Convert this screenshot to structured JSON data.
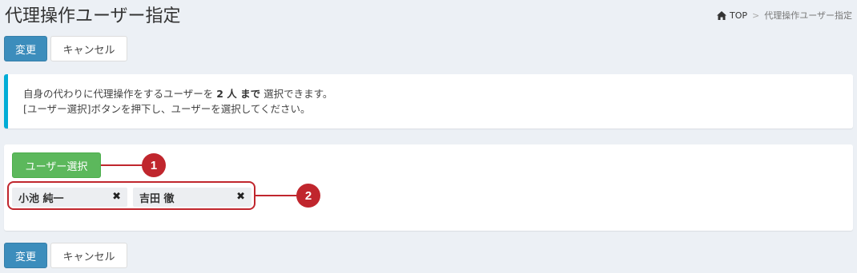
{
  "page": {
    "title": "代理操作ユーザー指定"
  },
  "breadcrumb": {
    "home_icon": "home-icon",
    "home_label": "TOP",
    "separator": ">",
    "current": "代理操作ユーザー指定"
  },
  "actions": {
    "submit_label": "変更",
    "cancel_label": "キャンセル"
  },
  "info": {
    "line1_before": "自身の代わりに代理操作をするユーザーを",
    "line1_bold": "2 人 まで",
    "line1_after": "選択できます。",
    "line2": "[ユーザー選択]ボタンを押下し、ユーザーを選択してください。"
  },
  "selection": {
    "select_button_label": "ユーザー選択",
    "users": [
      {
        "name": "小池 純一",
        "remove_icon": "close-icon"
      },
      {
        "name": "吉田 徹",
        "remove_icon": "close-icon"
      }
    ]
  },
  "annotations": {
    "marker1": "1",
    "marker2": "2",
    "color": "#c0262d"
  },
  "colors": {
    "primary": "#3c8dbc",
    "success": "#5cb85c",
    "info_accent": "#00acd6",
    "background": "#ecf0f5"
  }
}
